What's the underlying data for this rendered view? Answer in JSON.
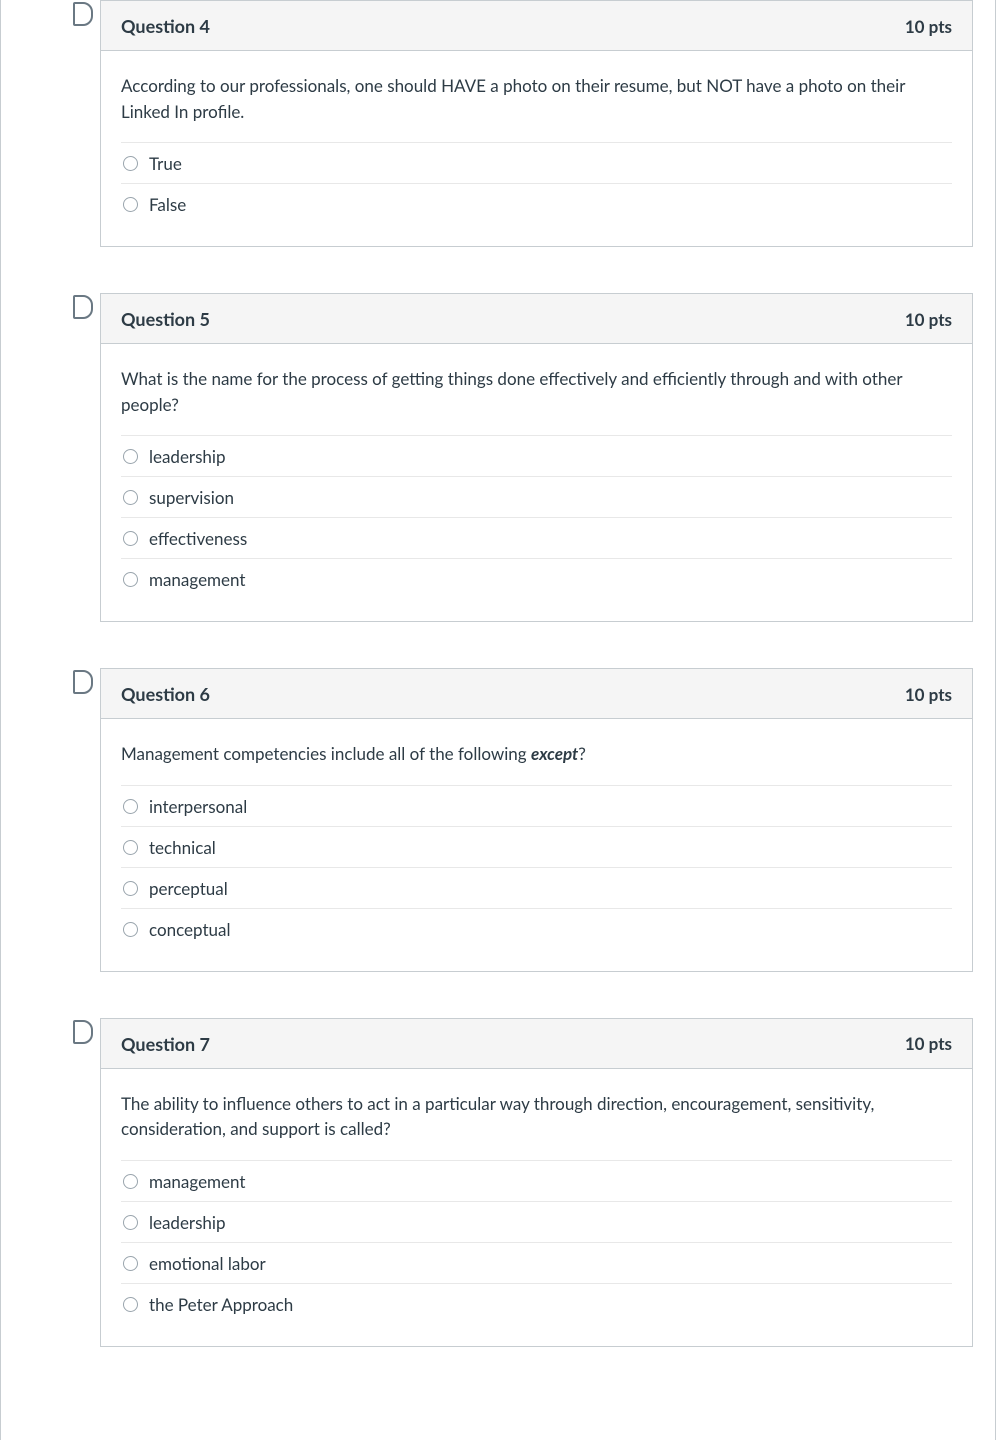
{
  "questions": [
    {
      "title": "Question 4",
      "points": "10 pts",
      "text": "According to our professionals, one should HAVE a photo on their resume, but NOT have a photo on their Linked In profile.",
      "answers": [
        "True",
        "False"
      ]
    },
    {
      "title": "Question 5",
      "points": "10 pts",
      "text": "What is the name for the process of getting things done effectively and efficiently through and with other people?",
      "answers": [
        "leadership",
        "supervision",
        "effectiveness",
        "management"
      ]
    },
    {
      "title": "Question 6",
      "points": "10 pts",
      "text_pre": "Management competencies include all of the following ",
      "emph": "except",
      "text_post": "?",
      "answers": [
        "interpersonal",
        "technical",
        "perceptual",
        "conceptual"
      ]
    },
    {
      "title": "Question 7",
      "points": "10 pts",
      "text": "The ability to influence others to act in a particular way through direction, encouragement, sensitivity, consideration, and support is called?",
      "answers": [
        "management",
        "leadership",
        "emotional labor",
        "the Peter Approach"
      ]
    }
  ]
}
